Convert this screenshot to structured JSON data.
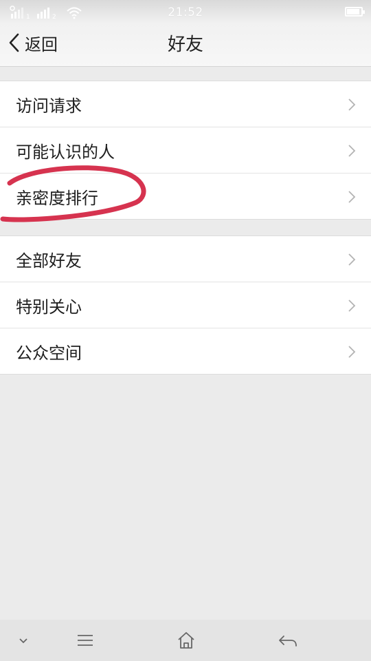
{
  "status_bar": {
    "time": "21:52",
    "signal_icons": [
      "signal-icon",
      "signal-icon",
      "wifi-icon"
    ],
    "battery_icon": "battery-icon"
  },
  "header": {
    "back_label": "返回",
    "title": "好友"
  },
  "groups": [
    {
      "items": [
        {
          "label": "访问请求"
        },
        {
          "label": "可能认识的人"
        },
        {
          "label": "亲密度排行"
        }
      ]
    },
    {
      "items": [
        {
          "label": "全部好友"
        },
        {
          "label": "特别关心"
        },
        {
          "label": "公众空间"
        }
      ]
    }
  ],
  "annotation": {
    "color": "#d6334f"
  },
  "system_nav": {
    "buttons": [
      "chevron-down-icon",
      "menu-icon",
      "home-icon",
      "back-icon"
    ]
  }
}
